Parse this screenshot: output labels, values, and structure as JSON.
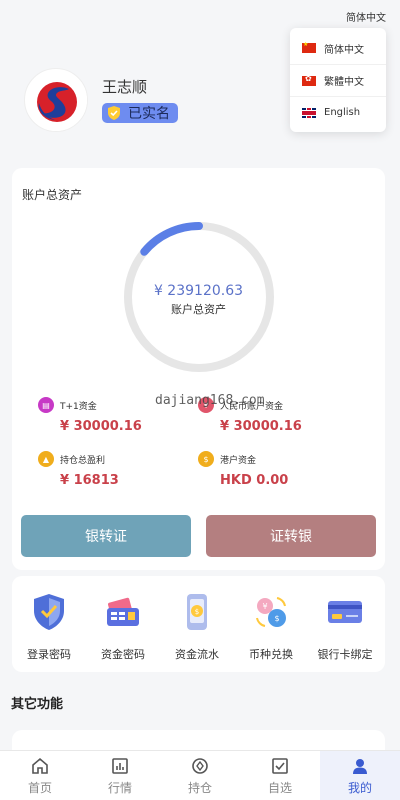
{
  "language": {
    "current": "简体中文",
    "options": [
      {
        "label": "简体中文",
        "flag": "flag-cn-icon"
      },
      {
        "label": "繁體中文",
        "flag": "flag-hk-icon"
      },
      {
        "label": "English",
        "flag": "flag-uk-icon"
      }
    ]
  },
  "profile": {
    "name": "王志顺",
    "verified_label": "已实名"
  },
  "assets": {
    "title": "账户总资产",
    "total_value": "¥ 239120.63",
    "total_label": "账户总资产",
    "progress_fraction": 0.14,
    "stats": [
      {
        "label": "T+1资金",
        "value": "¥ 30000.16",
        "icon": "wallet-icon",
        "color": "#c739c6"
      },
      {
        "label": "人民币账户资金",
        "value": "¥ 30000.16",
        "icon": "coin-icon",
        "color": "#e0556a"
      },
      {
        "label": "持仓总盈利",
        "value": "¥ 16813",
        "icon": "profit-icon",
        "color": "#f0ad1c"
      },
      {
        "label": "港户资金",
        "value": "HKD 0.00",
        "icon": "hk-fund-icon",
        "color": "#f0ad1c"
      }
    ],
    "watermark": "dajiang168.com",
    "bank_to_securities": "银转证",
    "securities_to_bank": "证转银"
  },
  "functions": [
    {
      "label": "登录密码",
      "icon": "shield-icon"
    },
    {
      "label": "资金密码",
      "icon": "card-reader-icon"
    },
    {
      "label": "资金流水",
      "icon": "phone-payment-icon"
    },
    {
      "label": "币种兑换",
      "icon": "currency-exchange-icon"
    },
    {
      "label": "银行卡绑定",
      "icon": "bank-card-icon"
    }
  ],
  "other_section_title": "其它功能",
  "tabs": [
    {
      "label": "首页",
      "icon": "home-icon",
      "active": false
    },
    {
      "label": "行情",
      "icon": "chart-icon",
      "active": false
    },
    {
      "label": "持仓",
      "icon": "holdings-icon",
      "active": false
    },
    {
      "label": "自选",
      "icon": "watchlist-icon",
      "active": false
    },
    {
      "label": "我的",
      "icon": "user-icon",
      "active": true
    }
  ],
  "colors": {
    "accent": "#3a5bd0",
    "value_red": "#c9414a",
    "bank_to_securities_btn": "#6fa3b8",
    "securities_to_bank_btn": "#b47f80"
  }
}
